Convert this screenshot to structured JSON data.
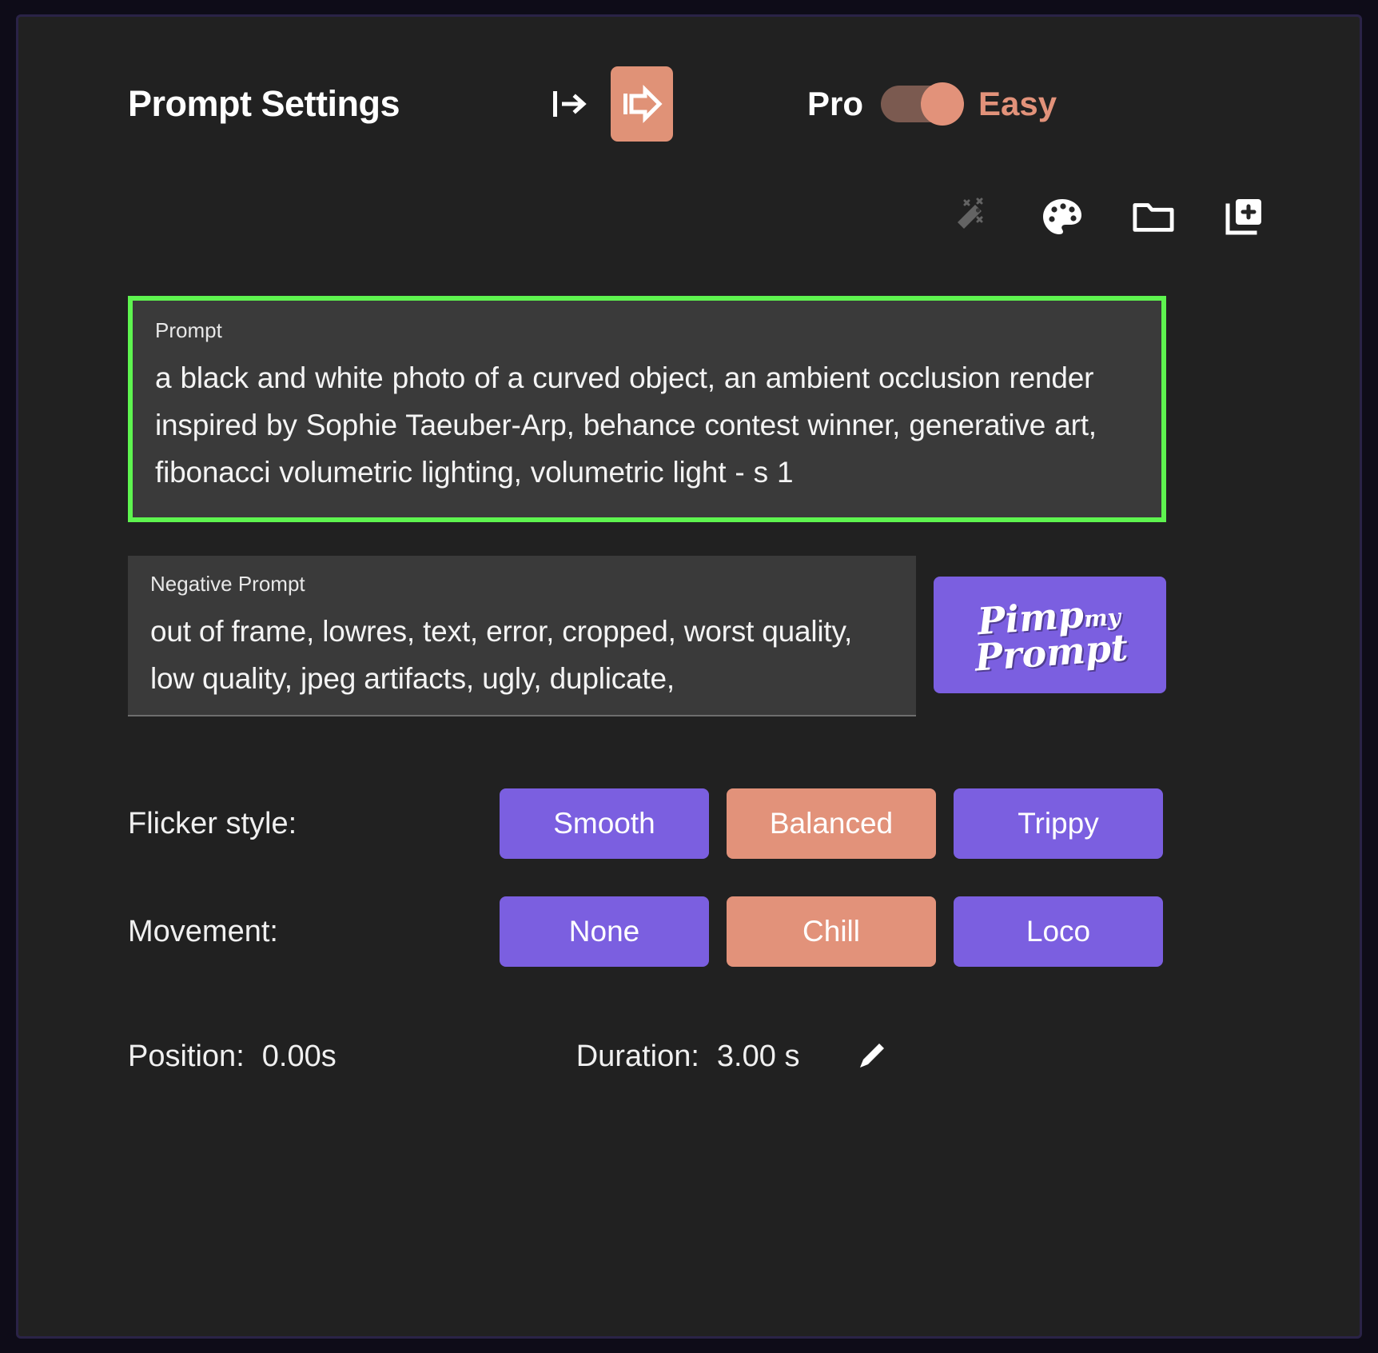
{
  "header": {
    "title": "Prompt Settings",
    "indent_decrease_icon": "indent-decrease-icon",
    "indent_increase_icon": "indent-increase-icon",
    "mode_left_label": "Pro",
    "mode_right_label": "Easy",
    "mode_toggle_state": "Easy",
    "accent_salmon": "#e2927a",
    "accent_purple": "#7b5fe0"
  },
  "toolbar": {
    "icons": [
      {
        "name": "magic-wand-icon",
        "label": "Magic Wand",
        "enabled": false
      },
      {
        "name": "palette-icon",
        "label": "Palette",
        "enabled": true
      },
      {
        "name": "folder-icon",
        "label": "Folder",
        "enabled": true
      },
      {
        "name": "add-page-icon",
        "label": "Add Page",
        "enabled": true
      }
    ]
  },
  "prompt": {
    "label": "Prompt",
    "value": "a black and white photo of a curved object, an ambient occlusion render inspired by Sophie Taeuber-Arp, behance contest winner, generative art, fibonacci volumetric lighting, volumetric light - s 1",
    "highlight_color": "#5ef44f"
  },
  "negative_prompt": {
    "label": "Negative Prompt",
    "value": "out of frame, lowres, text, error, cropped, worst quality, low quality, jpeg artifacts, ugly, duplicate,"
  },
  "pimp_button": {
    "line1_main": "Pimp",
    "line1_small": "my",
    "line2": "Prompt"
  },
  "flicker": {
    "label": "Flicker style:",
    "options": [
      {
        "label": "Smooth",
        "selected": false
      },
      {
        "label": "Balanced",
        "selected": true
      },
      {
        "label": "Trippy",
        "selected": false
      }
    ]
  },
  "movement": {
    "label": "Movement:",
    "options": [
      {
        "label": "None",
        "selected": false
      },
      {
        "label": "Chill",
        "selected": true
      },
      {
        "label": "Loco",
        "selected": false
      }
    ]
  },
  "timing": {
    "position_label": "Position:",
    "position_value": "0.00s",
    "duration_label": "Duration:",
    "duration_value": "3.00 s",
    "edit_icon": "pencil-icon"
  }
}
